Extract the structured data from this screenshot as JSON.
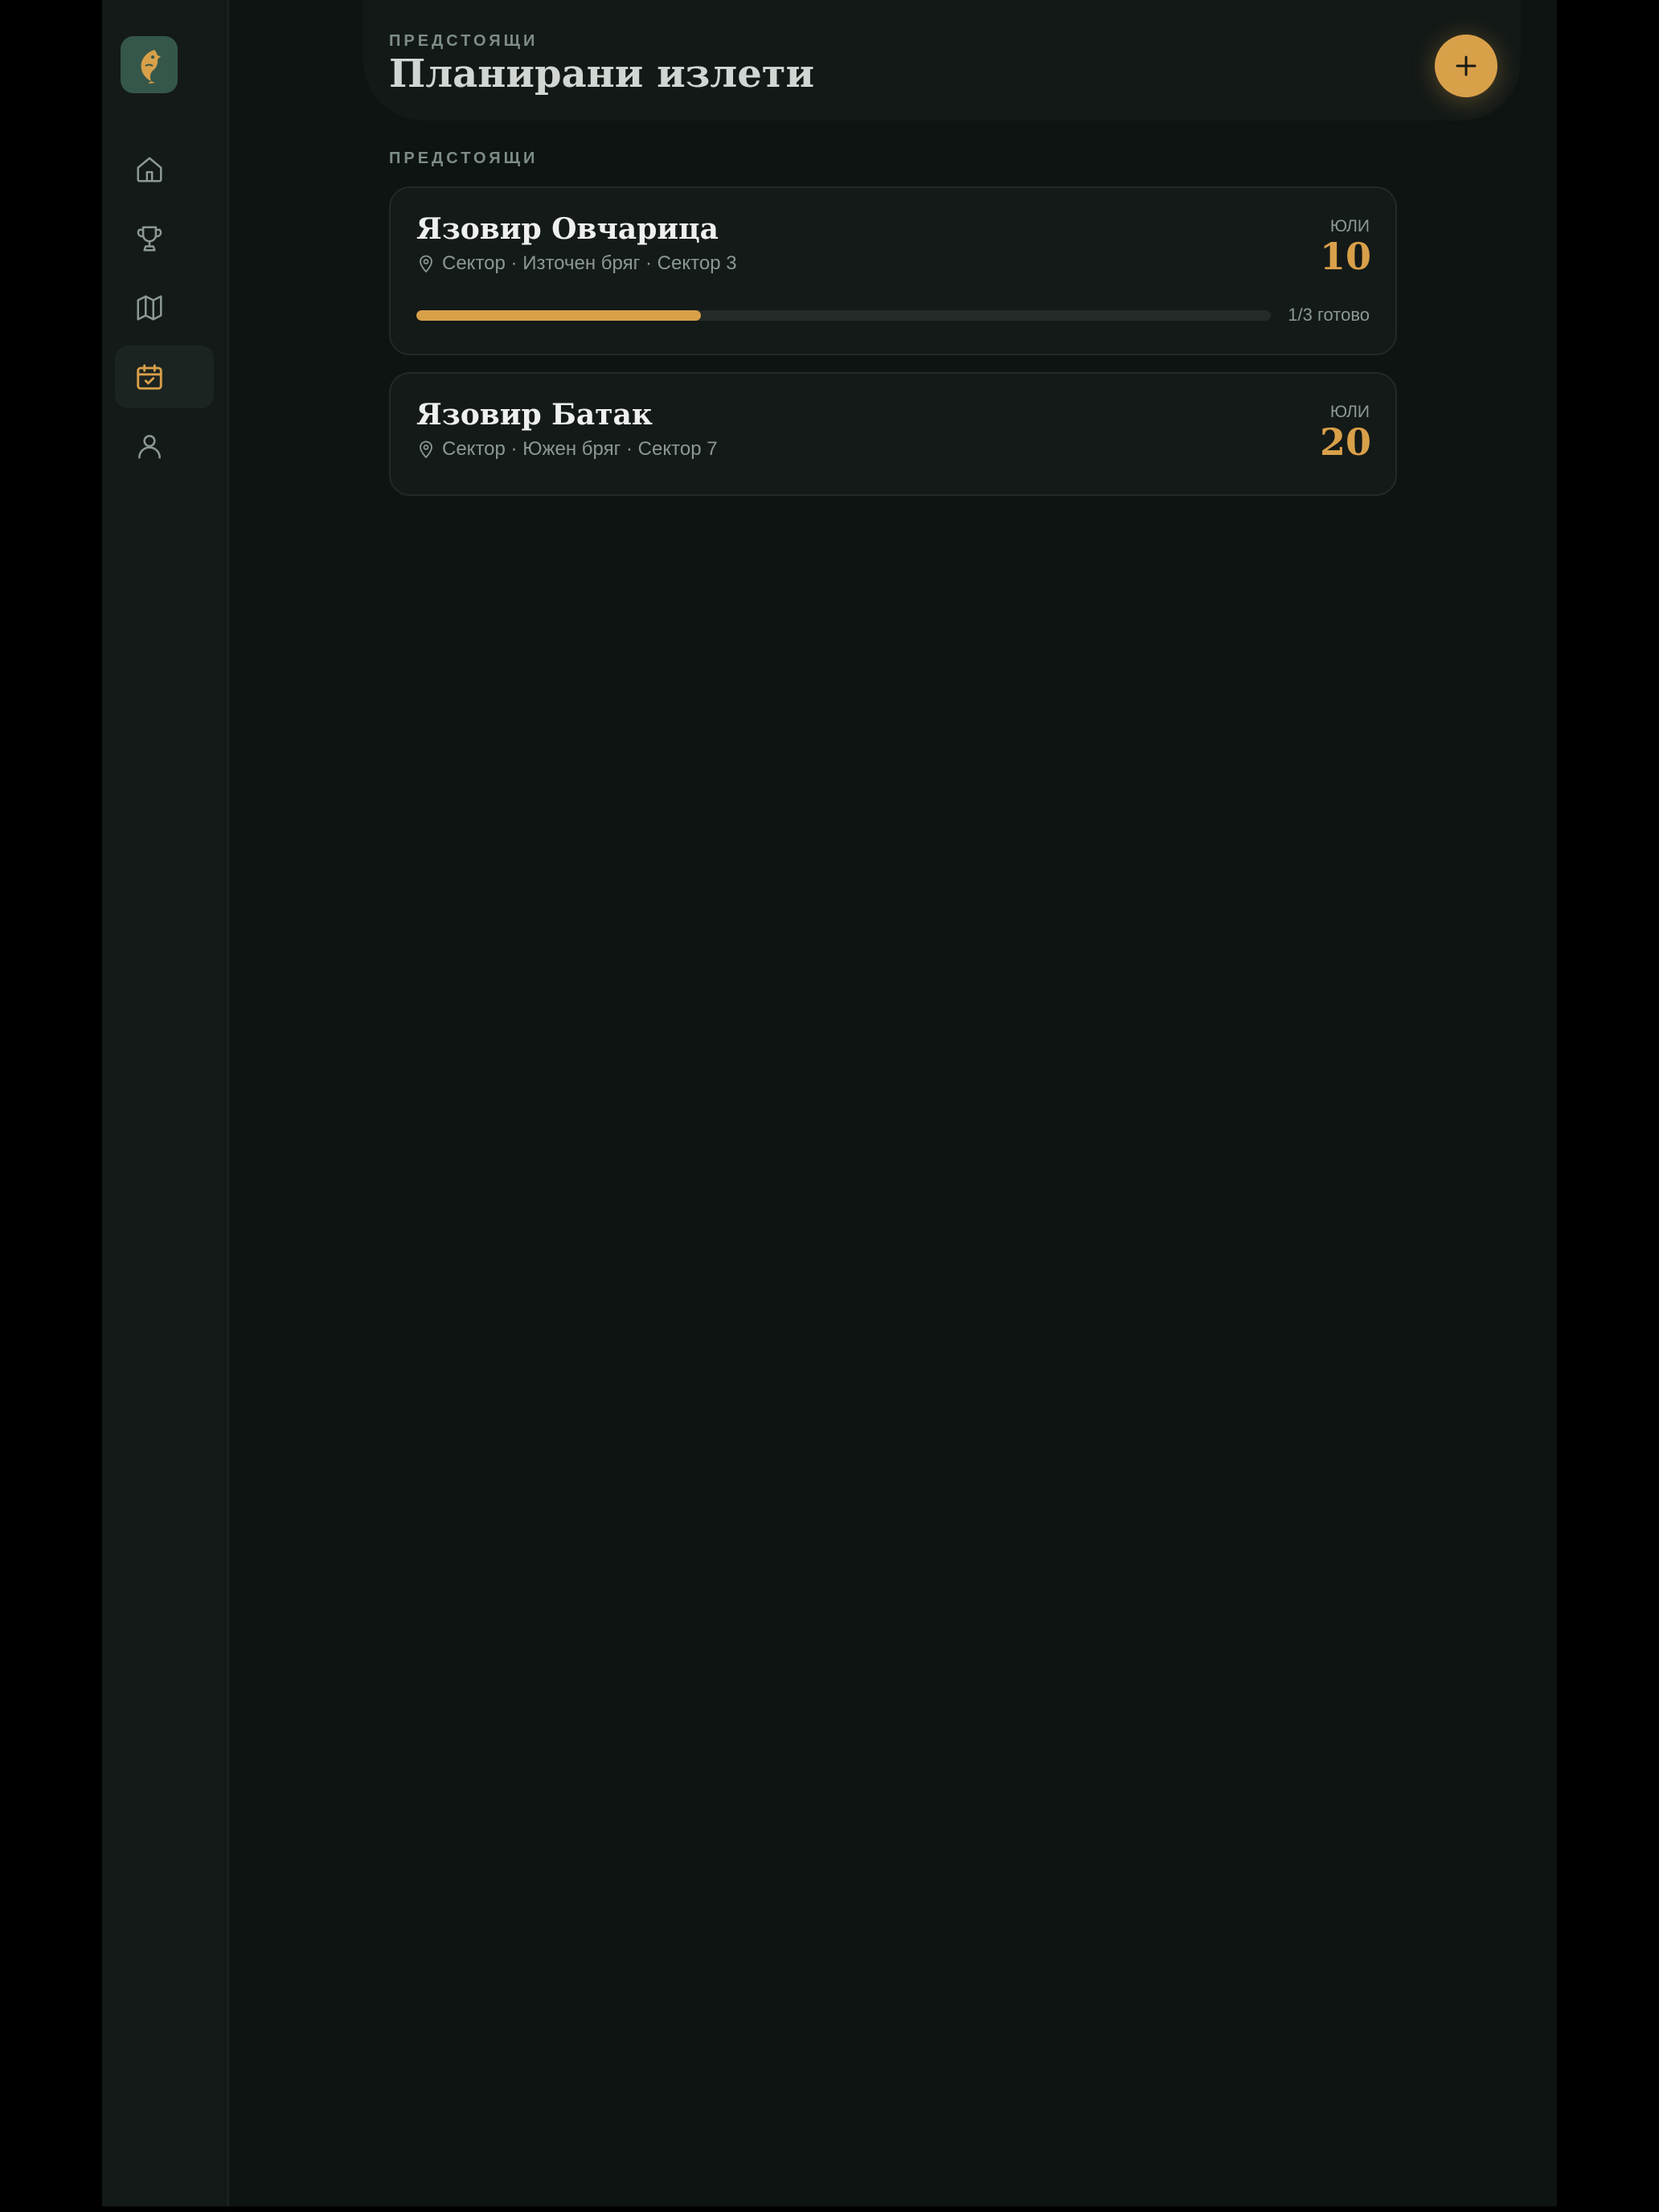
{
  "header": {
    "eyebrow": "ПРЕДСТОЯЩИ",
    "title": "Планирани излети"
  },
  "section_label": "ПРЕДСТОЯЩИ",
  "nav": {
    "items": [
      {
        "icon": "home-icon",
        "active": false
      },
      {
        "icon": "trophy-icon",
        "active": false
      },
      {
        "icon": "map-icon",
        "active": false
      },
      {
        "icon": "calendar-check-icon",
        "active": true
      },
      {
        "icon": "user-icon",
        "active": false
      }
    ]
  },
  "trips": [
    {
      "name": "Язовир Овчарица",
      "location": "Сектор · Източен бряг · Сектор 3",
      "month": "ЮЛИ",
      "day": "10",
      "progress_fraction": 0.3333,
      "progress_text": "1/3 готово"
    },
    {
      "name": "Язовир Батак",
      "location": "Сектор · Южен бряг · Сектор 7",
      "month": "ЮЛИ",
      "day": "20"
    }
  ],
  "colors": {
    "accent": "#d9a04a",
    "background": "#0e1412",
    "sidebar": "#141a18",
    "logo_bg": "#35574a",
    "muted_text": "#8b9893"
  }
}
